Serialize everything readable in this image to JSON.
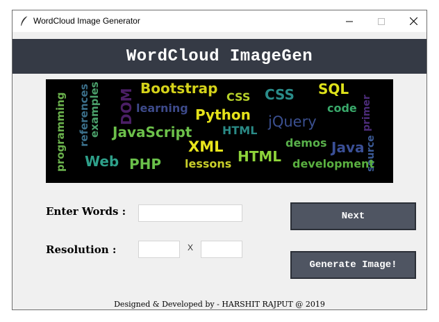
{
  "window": {
    "title": "WordCloud Image Generator",
    "minimize_glyph": "—",
    "maximize_glyph": "☐",
    "close_glyph": "✕"
  },
  "banner": {
    "title": "WordCloud ImageGen"
  },
  "wordcloud": {
    "words": [
      {
        "id": "programming",
        "text": "programming",
        "color": "#6ab04c"
      },
      {
        "id": "references",
        "text": "references",
        "color": "#3b6f8a"
      },
      {
        "id": "examples",
        "text": "examples",
        "color": "#4aa06a"
      },
      {
        "id": "dom",
        "text": "DOM",
        "color": "#4b1f66"
      },
      {
        "id": "bootstrap",
        "text": "Bootstrap",
        "color": "#d4d21a"
      },
      {
        "id": "learning",
        "text": "learning",
        "color": "#3d4a8a"
      },
      {
        "id": "css-small",
        "text": "CSS",
        "color": "#b6d12a"
      },
      {
        "id": "css-large",
        "text": "CSS",
        "color": "#2a8c8a"
      },
      {
        "id": "sql",
        "text": "SQL",
        "color": "#dfe21a"
      },
      {
        "id": "code",
        "text": "code",
        "color": "#39a86a"
      },
      {
        "id": "primer",
        "text": "primer",
        "color": "#4b2b78"
      },
      {
        "id": "source",
        "text": "source",
        "color": "#3b5a96"
      },
      {
        "id": "python",
        "text": "Python",
        "color": "#e5e21a"
      },
      {
        "id": "javascript",
        "text": "JavaScript",
        "color": "#6cc04a"
      },
      {
        "id": "html-small",
        "text": "HTML",
        "color": "#2a8a86"
      },
      {
        "id": "jquery",
        "text": "jQuery",
        "color": "#3a4f8f"
      },
      {
        "id": "xml",
        "text": "XML",
        "color": "#e9e51c"
      },
      {
        "id": "demos",
        "text": "demos",
        "color": "#58b04a"
      },
      {
        "id": "java",
        "text": "Java",
        "color": "#3a4f96"
      },
      {
        "id": "web",
        "text": "Web",
        "color": "#2ea08a"
      },
      {
        "id": "php",
        "text": "PHP",
        "color": "#6ac04a"
      },
      {
        "id": "lessons",
        "text": "lessons",
        "color": "#c9cf2a"
      },
      {
        "id": "html-large",
        "text": "HTML",
        "color": "#8ed43a"
      },
      {
        "id": "development",
        "text": "development",
        "color": "#5ab040"
      }
    ]
  },
  "form": {
    "words_label": "Enter Words :",
    "words_value": "",
    "resolution_label": "Resolution :",
    "width_value": "",
    "height_value": "",
    "separator": "X"
  },
  "buttons": {
    "next_label": "Next",
    "generate_label": "Generate Image!"
  },
  "footer": {
    "text": "Designed & Developed by - HARSHIT RAJPUT @ 2019"
  }
}
